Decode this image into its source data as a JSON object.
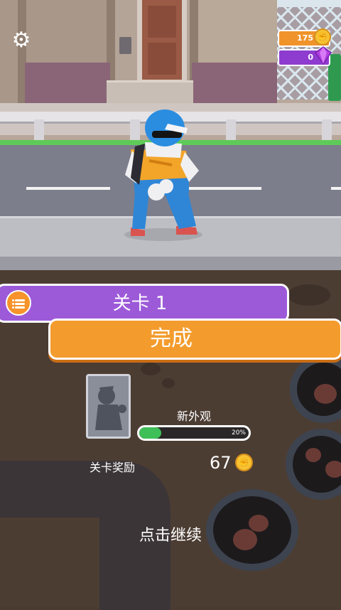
{
  "hud": {
    "coins": "175",
    "gems": "0"
  },
  "level_panel": {
    "title": "关卡 1",
    "done_button": "完成"
  },
  "reward_panel": {
    "new_skin_label": "新外观",
    "skin_progress_text": "20%",
    "skin_progress_fraction": 0.2,
    "level_reward_label": "关卡奖励",
    "level_reward_value": "67"
  },
  "continue_text": "点击继续",
  "colors": {
    "accent_orange": "#f39c2d",
    "banner_purple": "#9c5ad9",
    "progress_green": "#3fbf58",
    "coin_gold": "#f7c131"
  }
}
